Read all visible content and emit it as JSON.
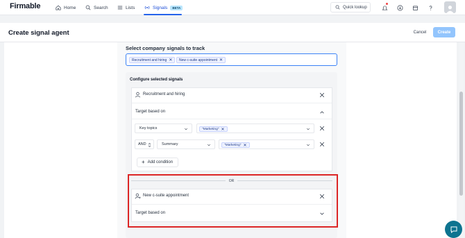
{
  "app": {
    "logo": "Firmable"
  },
  "nav": {
    "items": [
      {
        "label": "Home",
        "icon": "home-icon"
      },
      {
        "label": "Search",
        "icon": "search-icon"
      },
      {
        "label": "Lists",
        "icon": "list-icon"
      },
      {
        "label": "Signals",
        "icon": "signal-icon",
        "badge": "BETA",
        "active": true
      }
    ],
    "quick_lookup": "Quick lookup",
    "right_icons": [
      "notification-icon",
      "download-icon",
      "calendar-icon",
      "help-icon",
      "avatar"
    ]
  },
  "header": {
    "title": "Create signal agent",
    "cancel_label": "Cancel",
    "create_label": "Create"
  },
  "signals": {
    "section_title": "Select company signals to track",
    "selected_tags": [
      "Recruitment and hiring",
      "New c-suite appointment"
    ]
  },
  "config": {
    "title": "Configure selected signals",
    "signal_1": {
      "name": "Recruitment and hiring",
      "target_label": "Target based on",
      "conditions": [
        {
          "operator": "",
          "field": "Key topics",
          "value": "\"Marketing\""
        },
        {
          "operator": "AND",
          "field": "Summary",
          "value": "\"Marketing\""
        }
      ],
      "add_condition_label": "Add condition"
    },
    "or_label": "OR",
    "signal_2": {
      "name": "New c-suite appointment",
      "target_label": "Target based on"
    }
  },
  "colors": {
    "accent": "#2563eb",
    "highlight": "#dc2626",
    "chat": "#0e7490"
  }
}
